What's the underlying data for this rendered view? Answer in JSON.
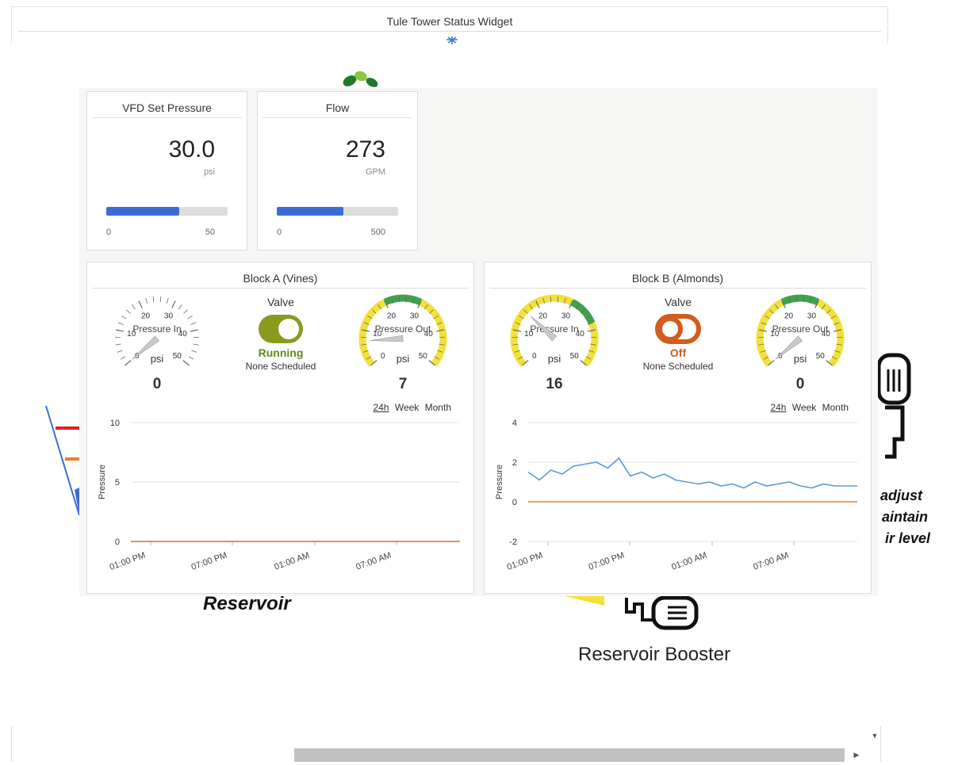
{
  "widget": {
    "title": "Tule Tower Status Widget"
  },
  "background": {
    "reservoir_label": "Reservoir",
    "booster_label": "Reservoir Booster",
    "note_lines": [
      "adjust",
      "aintain",
      "ir level"
    ]
  },
  "vfd": {
    "title": "VFD Set Pressure",
    "value": "30.0",
    "unit": "psi",
    "min": "0",
    "max": "50",
    "fraction": 0.6
  },
  "flow": {
    "title": "Flow",
    "value": "273",
    "unit": "GPM",
    "min": "0",
    "max": "500",
    "fraction": 0.546
  },
  "block_a": {
    "title": "Block A (Vines)",
    "pressure_in": {
      "label": "Pressure In",
      "unit": "psi",
      "value": "0",
      "ticks": [
        "0",
        "10",
        "20",
        "30",
        "40",
        "50"
      ]
    },
    "valve": {
      "title": "Valve",
      "state": "Running",
      "schedule": "None Scheduled",
      "color": "#8a9a1f"
    },
    "pressure_out": {
      "label": "Pressure Out",
      "unit": "psi",
      "value": "7",
      "ticks": [
        "0",
        "10",
        "20",
        "30",
        "40",
        "50"
      ]
    },
    "range": {
      "day": "24h",
      "week": "Week",
      "month": "Month"
    }
  },
  "block_b": {
    "title": "Block B (Almonds)",
    "pressure_in": {
      "label": "Pressure In",
      "unit": "psi",
      "value": "16",
      "ticks": [
        "0",
        "10",
        "20",
        "30",
        "40",
        "50"
      ]
    },
    "valve": {
      "title": "Valve",
      "state": "Off",
      "schedule": "None Scheduled",
      "color": "#d35b1e"
    },
    "pressure_out": {
      "label": "Pressure Out",
      "unit": "psi",
      "value": "0",
      "ticks": [
        "0",
        "10",
        "20",
        "30",
        "40",
        "50"
      ]
    },
    "range": {
      "day": "24h",
      "week": "Week",
      "month": "Month"
    }
  },
  "colors": {
    "bar": "#3d6bd6",
    "series_in": "#5b9bd5",
    "series_out": "#ed7d31",
    "gauge_green": "#3fa34d",
    "gauge_yellow": "#f2e13b",
    "running": "#8a9a1f",
    "off": "#d35b1e"
  },
  "chart_data": [
    {
      "type": "line",
      "ylabel": "Pressure",
      "yticks": [
        10,
        5,
        0
      ],
      "ylim": [
        0,
        10
      ],
      "xticks": [
        "01:00 PM",
        "07:00 PM",
        "01:00 AM",
        "07:00 AM"
      ],
      "series": [
        {
          "values": [
            0,
            0,
            0,
            0,
            0,
            0,
            0,
            0
          ]
        },
        {
          "values": [
            0,
            0,
            0,
            0,
            0,
            0,
            0,
            0
          ]
        }
      ]
    },
    {
      "type": "line",
      "ylabel": "Pressure",
      "yticks": [
        4,
        2,
        0,
        -2
      ],
      "ylim": [
        -2,
        4
      ],
      "xticks": [
        "01:00 PM",
        "07:00 PM",
        "01:00 AM",
        "07:00 AM"
      ],
      "series": [
        {
          "values": [
            1.5,
            1.1,
            1.6,
            1.4,
            1.8,
            1.9,
            2.0,
            1.7,
            2.2,
            1.3,
            1.5,
            1.2,
            1.4,
            1.1,
            1.0,
            0.9,
            1.0,
            0.8,
            0.9,
            0.7,
            1.0,
            0.8,
            0.9,
            1.0,
            0.8,
            0.7,
            0.9,
            0.8,
            0.8,
            0.8
          ]
        },
        {
          "values": [
            0,
            0,
            0,
            0,
            0,
            0,
            0,
            0,
            0,
            0,
            0,
            0,
            0,
            0,
            0,
            0,
            0,
            0,
            0,
            0,
            0,
            0,
            0,
            0,
            0,
            0,
            0,
            0,
            0,
            0
          ]
        }
      ]
    }
  ]
}
